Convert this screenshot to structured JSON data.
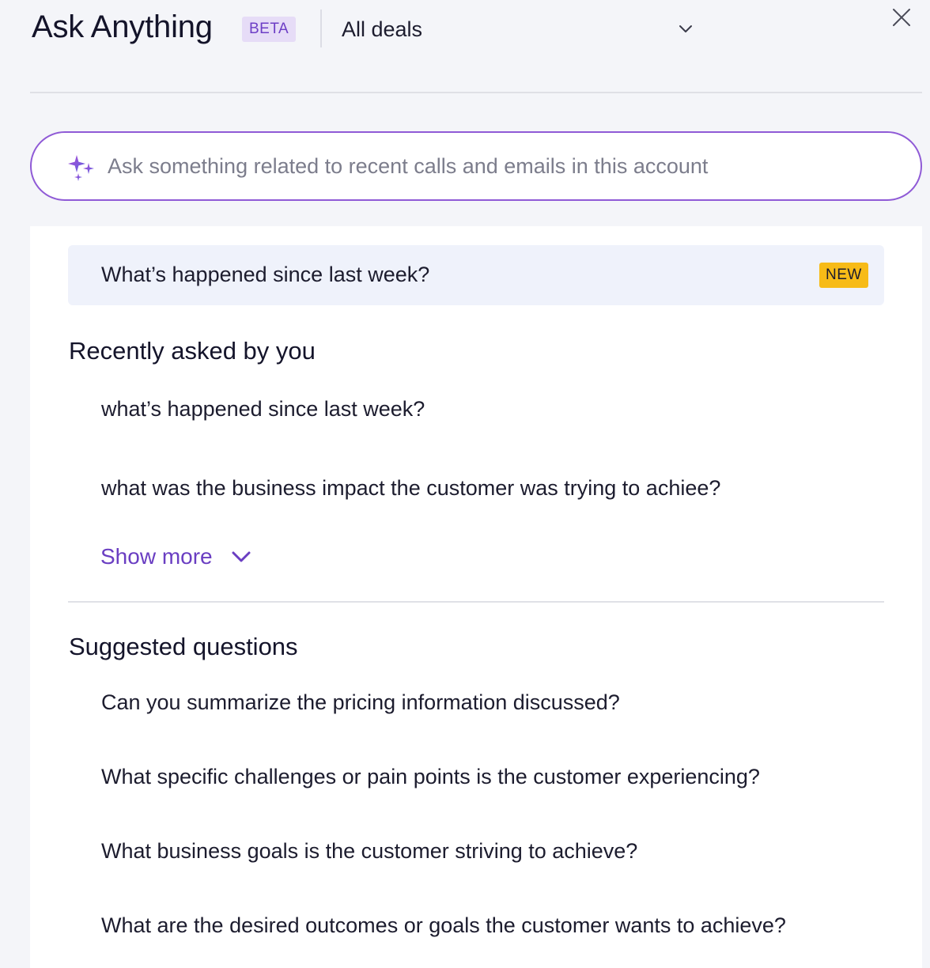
{
  "header": {
    "title": "Ask Anything",
    "badge": "BETA",
    "deal_filter": {
      "selected": "All deals"
    }
  },
  "search": {
    "placeholder": "Ask something related to recent calls and emails in this account",
    "value": ""
  },
  "whats_new": {
    "label": "What’s happened since last week?",
    "badge": "NEW"
  },
  "recent": {
    "heading": "Recently asked by you",
    "items": [
      "what’s happened since last week?",
      "what was the business impact the customer was trying to achiee?"
    ],
    "show_more_label": "Show more"
  },
  "suggested": {
    "heading": "Suggested questions",
    "items": [
      "Can you summarize the pricing information discussed?",
      "What specific challenges or pain points is the customer experiencing?",
      "What business goals is the customer striving to achieve?",
      "What are the desired outcomes or goals the customer wants to achieve?"
    ]
  },
  "colors": {
    "accent_purple": "#8f5ad6",
    "link_purple": "#6a3ec2",
    "beta_bg": "#e6dcf7",
    "new_badge_bg": "#f7bb17",
    "highlight_bg": "#eff2fb",
    "page_bg": "#f4f5f9"
  },
  "icons": {
    "search": "sparkles-icon",
    "dropdown": "chevron-down-icon",
    "close": "close-icon",
    "show_more": "chevron-down-icon"
  }
}
